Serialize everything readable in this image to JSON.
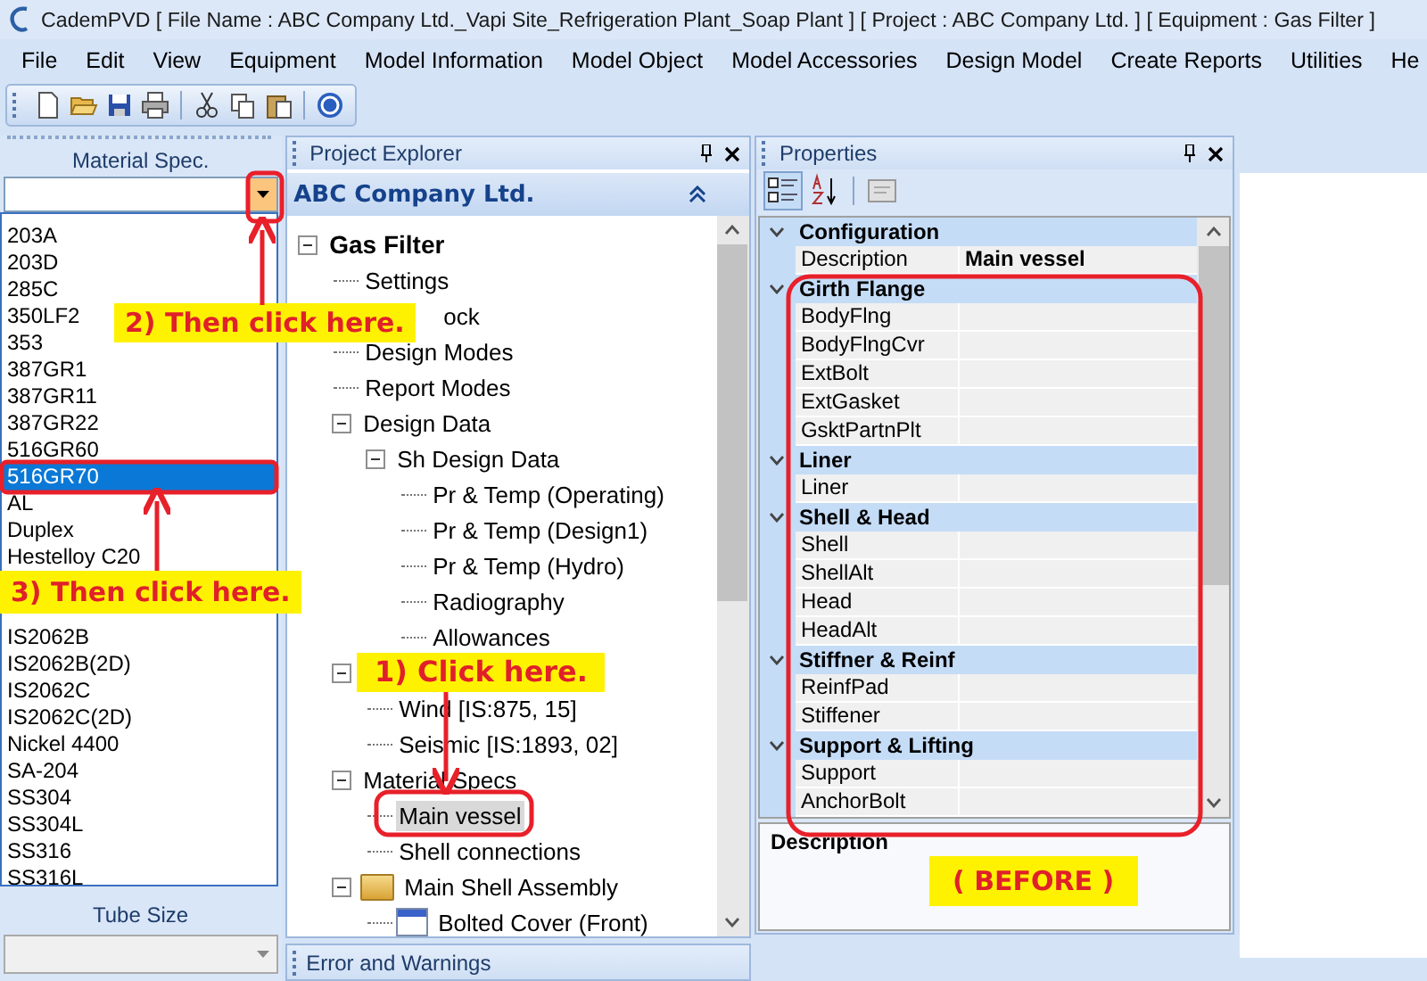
{
  "window": {
    "title": "CademPVD [ File Name : ABC Company Ltd._Vapi Site_Refrigeration Plant_Soap Plant ] [ Project : ABC Company Ltd. ] [ Equipment : Gas Filter ]"
  },
  "menu": [
    "File",
    "Edit",
    "View",
    "Equipment",
    "Model Information",
    "Model Object",
    "Model Accessories",
    "Design Model",
    "Create Reports",
    "Utilities",
    "He"
  ],
  "toolbar": [
    {
      "kind": "new"
    },
    {
      "kind": "open"
    },
    {
      "kind": "save"
    },
    {
      "kind": "print"
    },
    {
      "kind": "sep"
    },
    {
      "kind": "cut"
    },
    {
      "kind": "copy"
    },
    {
      "kind": "paste"
    },
    {
      "kind": "sep"
    },
    {
      "kind": "help"
    }
  ],
  "material_panel": {
    "title": "Material Spec.",
    "items": [
      {
        "label": "203A",
        "selected": false
      },
      {
        "label": "203D",
        "selected": false
      },
      {
        "label": "285C",
        "selected": false
      },
      {
        "label": "350LF2",
        "selected": false
      },
      {
        "label": "353",
        "selected": false
      },
      {
        "label": "387GR1",
        "selected": false
      },
      {
        "label": "387GR11",
        "selected": false
      },
      {
        "label": "387GR22",
        "selected": false
      },
      {
        "label": "516GR60",
        "selected": false
      },
      {
        "label": "516GR70",
        "selected": true
      },
      {
        "label": "AL",
        "selected": false
      },
      {
        "label": "Duplex",
        "selected": false
      },
      {
        "label": "Hestelloy C20",
        "selected": false
      },
      {
        "label": "IS2062B",
        "selected": false
      },
      {
        "label": "IS2062B(2D)",
        "selected": false
      },
      {
        "label": "IS2062C",
        "selected": false
      },
      {
        "label": "IS2062C(2D)",
        "selected": false
      },
      {
        "label": "Nickel 4400",
        "selected": false
      },
      {
        "label": "SA-204",
        "selected": false
      },
      {
        "label": "SS304",
        "selected": false
      },
      {
        "label": "SS304L",
        "selected": false
      },
      {
        "label": "SS316",
        "selected": false
      },
      {
        "label": "SS316L",
        "selected": false
      }
    ],
    "tube_size_title": "Tube Size"
  },
  "explorer": {
    "title": "Project Explorer",
    "company": "ABC Company Ltd.",
    "tree": [
      {
        "label": "Gas Filter",
        "selected": false,
        "expanded": true,
        "children": [
          {
            "label": "Settings",
            "selected": false
          },
          {
            "label": "ock",
            "selected": false
          },
          {
            "label": "Design Modes",
            "selected": false
          },
          {
            "label": "Report Modes",
            "selected": false
          },
          {
            "label": "Design Data",
            "selected": false,
            "expanded": true,
            "children": [
              {
                "label": "Sh Design Data",
                "selected": false,
                "expanded": true,
                "children": [
                  {
                    "label": "Pr & Temp (Operating)",
                    "selected": false
                  },
                  {
                    "label": "Pr & Temp (Design1)",
                    "selected": false
                  },
                  {
                    "label": "Pr & Temp (Hydro)",
                    "selected": false
                  },
                  {
                    "label": "Radiography",
                    "selected": false
                  },
                  {
                    "label": "Allowances",
                    "selected": false
                  }
                ]
              }
            ]
          },
          {
            "expanded": true,
            "children": [
              {
                "label": "Wind [IS:875, 15]",
                "selected": false
              },
              {
                "label": "Seismic [IS:1893, 02]",
                "selected": false
              }
            ]
          },
          {
            "label": "Material Specs",
            "selected": false,
            "expanded": true,
            "children": [
              {
                "label": "Main vessel",
                "selected": true
              },
              {
                "label": "Shell connections",
                "selected": false
              }
            ]
          },
          {
            "label": "Main Shell Assembly",
            "kind": "folder",
            "selected": false,
            "expanded": true,
            "children": [
              {
                "label": "Bolted Cover (Front)",
                "kind": "cover",
                "selected": false
              }
            ]
          }
        ]
      }
    ]
  },
  "properties": {
    "title": "Properties",
    "categories": [
      {
        "name": "Configuration",
        "expanded": true,
        "rows": [
          {
            "name": "Description",
            "value": "Main vessel"
          }
        ]
      },
      {
        "name": "Girth Flange",
        "expanded": true,
        "rows": [
          {
            "name": "BodyFlng"
          },
          {
            "name": "BodyFlngCvr"
          },
          {
            "name": "ExtBolt"
          },
          {
            "name": "ExtGasket"
          },
          {
            "name": "GsktPartnPlt"
          }
        ]
      },
      {
        "name": "Liner",
        "expanded": true,
        "rows": [
          {
            "name": "Liner"
          }
        ]
      },
      {
        "name": "Shell & Head",
        "expanded": true,
        "rows": [
          {
            "name": "Shell"
          },
          {
            "name": "ShellAlt"
          },
          {
            "name": "Head"
          },
          {
            "name": "HeadAlt"
          }
        ]
      },
      {
        "name": "Stiffner & Reinf",
        "expanded": true,
        "rows": [
          {
            "name": "ReinfPad"
          },
          {
            "name": "Stiffener"
          }
        ]
      },
      {
        "name": "Support & Lifting",
        "expanded": true,
        "rows": [
          {
            "name": "Support"
          },
          {
            "name": "AnchorBolt"
          }
        ]
      }
    ],
    "description_title": "Description"
  },
  "error_panel": {
    "title": "Error and Warnings"
  },
  "annotations": [
    {
      "text": "2) Then click here."
    },
    {
      "text": "3) Then click here."
    },
    {
      "text": "1) Click here."
    },
    {
      "text": "( BEFORE )"
    }
  ]
}
